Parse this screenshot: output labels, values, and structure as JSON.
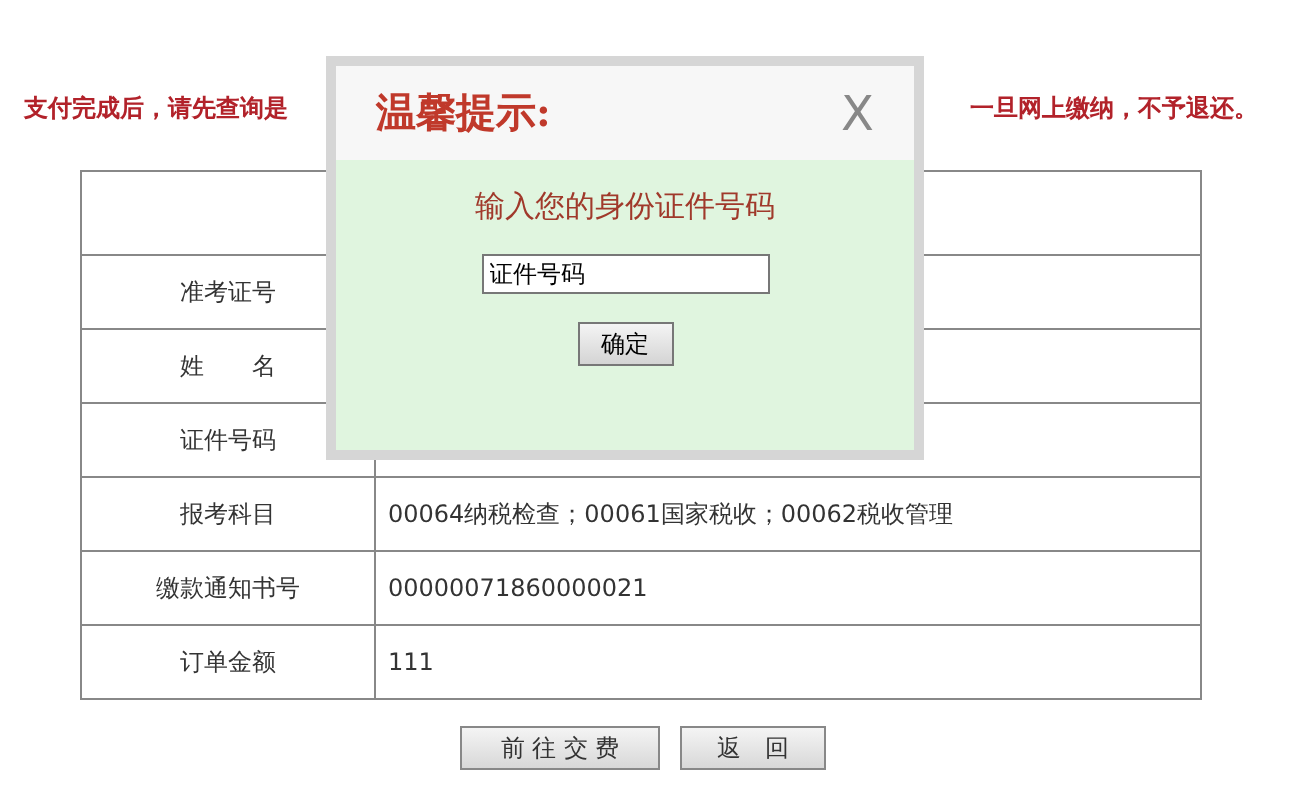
{
  "notice": {
    "left": "支付完成后，请先查询是",
    "right": "一旦网上缴纳，不予退还。"
  },
  "table": {
    "rows": [
      {
        "label": "准考证号"
      },
      {
        "label": "姓　　名"
      },
      {
        "label": "证件号码"
      },
      {
        "label": "报考科目",
        "value": "00064纳税检查；00061国家税收；00062税收管理"
      },
      {
        "label": "缴款通知书号",
        "value": "00000071860000021"
      },
      {
        "label": "订单金额",
        "value": "111"
      }
    ]
  },
  "buttons": [
    "前 往 交 费",
    "返　回"
  ],
  "dialog": {
    "title": "温馨提示:",
    "close": "X",
    "prompt": "输入您的身份证件号码",
    "field": {
      "value": "证件号码"
    },
    "confirm": "确定"
  }
}
